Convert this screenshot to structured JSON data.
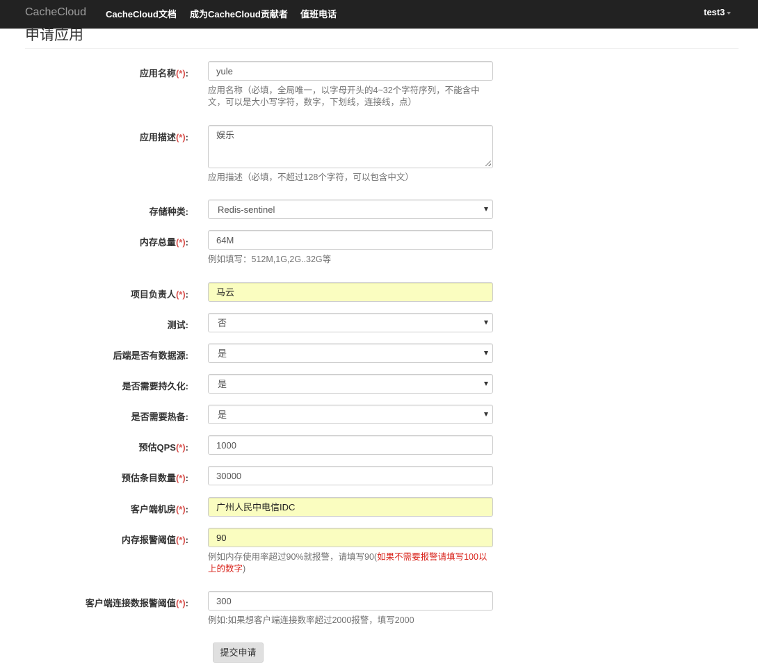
{
  "navbar": {
    "brand": "CacheCloud",
    "links": [
      "CacheCloud文档",
      "成为CacheCloud贡献者",
      "值班电话"
    ],
    "user": "test3"
  },
  "page": {
    "title": "申请应用"
  },
  "required_mark": "(*)",
  "form": {
    "app_name": {
      "label": "应用名称",
      "value": "yule",
      "help": "应用名称（必填，全局唯一，以字母开头的4~32个字符序列，不能含中文，可以是大小写字符，数字，下划线，连接线，点）"
    },
    "app_desc": {
      "label": "应用描述",
      "value": "娱乐",
      "help": "应用描述（必填，不超过128个字符，可以包含中文）"
    },
    "storage_type": {
      "label": "存储种类:",
      "value": "Redis-sentinel"
    },
    "memory": {
      "label": "内存总量",
      "value": "64M",
      "help": "例如填写：512M,1G,2G..32G等"
    },
    "owner": {
      "label": "项目负责人",
      "value": "马云"
    },
    "test": {
      "label": "测试:",
      "value": "否"
    },
    "has_backend": {
      "label": "后端是否有数据源:",
      "value": "是"
    },
    "persistence": {
      "label": "是否需要持久化:",
      "value": "是"
    },
    "hot_standby": {
      "label": "是否需要热备:",
      "value": "是"
    },
    "qps": {
      "label": "预估QPS",
      "value": "1000"
    },
    "entries": {
      "label": "预估条目数量",
      "value": "30000"
    },
    "client_room": {
      "label": "客户端机房",
      "value": "广州人民中电信IDC"
    },
    "mem_alert": {
      "label": "内存报警阈值",
      "value": "90",
      "help_prefix": "例如内存使用率超过90%就报警，请填写90(",
      "help_red": "如果不需要报警请填写100以上的数字",
      "help_suffix": ")"
    },
    "conn_alert": {
      "label": "客户端连接数报警阈值",
      "value": "300",
      "help": "例如:如果想客户端连接数率超过2000报警，填写2000"
    }
  },
  "submit_label": "提交申请",
  "colors": {
    "navbar_bg": "#222222",
    "highlight_bg": "#fafdc0",
    "required": "#d9534f"
  }
}
